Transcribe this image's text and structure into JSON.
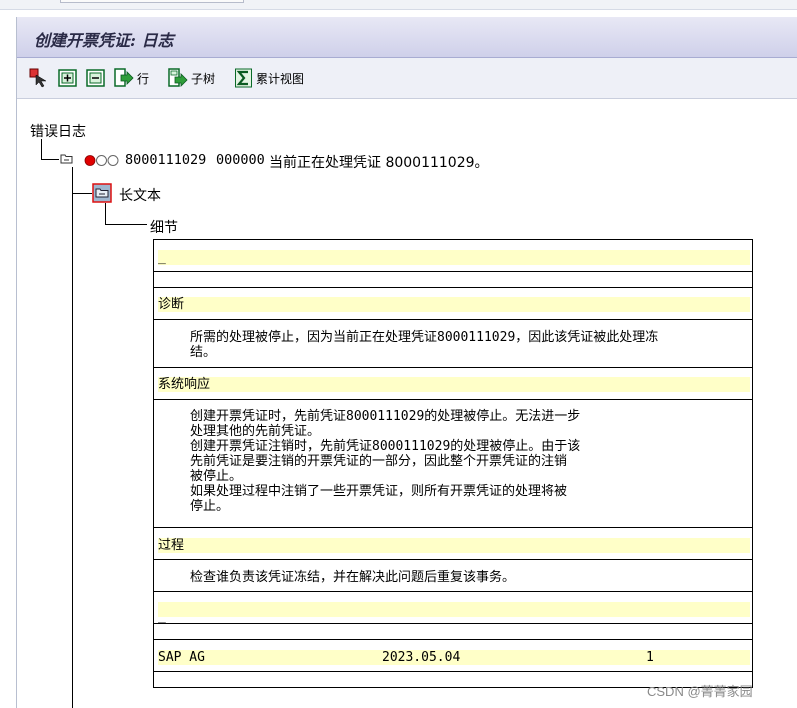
{
  "window": {
    "title": "创建开票凭证: 日志"
  },
  "toolbar": {
    "items": [
      {
        "icon": "select-detail-icon",
        "label": ""
      },
      {
        "icon": "expand-all-icon",
        "label": ""
      },
      {
        "icon": "collapse-all-icon",
        "label": ""
      },
      {
        "icon": "row-icon",
        "label": "行"
      },
      {
        "icon": "subtree-icon",
        "label": "子树"
      },
      {
        "icon": "sigma-icon",
        "label": "累计视图"
      }
    ]
  },
  "tree": {
    "root_label": "错误日志",
    "message": {
      "doc_no": "8000111029",
      "seq": "000000",
      "text": "当前正在处理凭证 8000111029。"
    },
    "long_text_node": "长文本",
    "detail_node": "细节"
  },
  "longtext": {
    "cursor": "_",
    "diagnosis_header": "诊断",
    "diagnosis_text": "所需的处理被停止，因为当前正在处理凭证8000111029，因此该凭证被此处理冻结。",
    "system_response_header": "系统响应",
    "system_response_lines": [
      "创建开票凭证时，先前凭证8000111029的处理被停止。无法进一步",
      "处理其他的先前凭证。",
      "创建开票凭证注销时，先前凭证8000111029的处理被停止。由于该",
      "先前凭证是要注销的开票凭证的一部分，因此整个开票凭证的注销",
      "被停止。",
      "如果处理过程中注销了一些开票凭证，则所有开票凭证的处理将被",
      "停止。"
    ],
    "procedure_header": "过程",
    "procedure_text": "检查谁负责该凭证冻结，并在解决此问题后重复该事务。",
    "cursor2": "_",
    "footer": {
      "company": "SAP AG",
      "date": "2023.05.04",
      "page": "1"
    }
  },
  "watermark": "CSDN @菁菁家园",
  "colors": {
    "title_bar": "#cfd0ea",
    "highlight": "#ffffc8",
    "toolbar": "#eef0f7",
    "status_red": "#e00000"
  }
}
